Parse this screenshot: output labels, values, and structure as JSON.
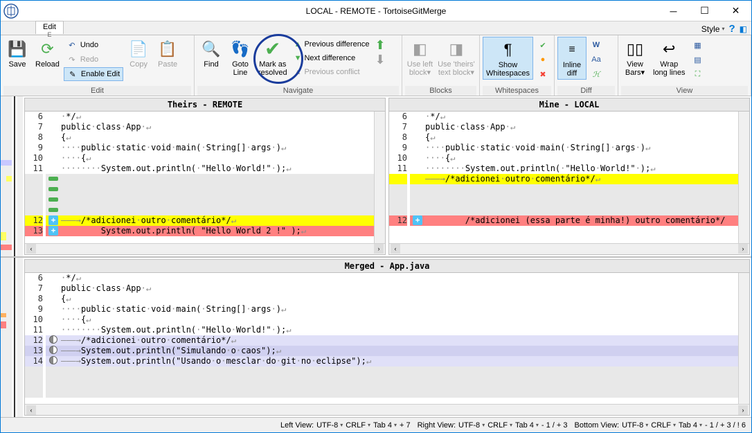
{
  "window": {
    "title": "LOCAL - REMOTE - TortoiseGitMerge",
    "style_label": "Style"
  },
  "tab": {
    "label": "Edit",
    "accel": "E"
  },
  "ribbon": {
    "save": "Save",
    "reload": "Reload",
    "undo": "Undo",
    "redo": "Redo",
    "enable_edit": "Enable Edit",
    "copy": "Copy",
    "paste": "Paste",
    "find": "Find",
    "goto_line": "Goto\nLine",
    "mark_resolved": "Mark as\nresolved",
    "prev_diff": "Previous difference",
    "next_diff": "Next difference",
    "prev_conflict": "Previous conflict",
    "use_left": "Use left\nblock▾",
    "use_theirs": "Use 'theirs'\ntext block▾",
    "show_ws": "Show\nWhitespaces",
    "inline_diff": "Inline\ndiff",
    "view_bars": "View\nBars▾",
    "wrap": "Wrap\nlong lines",
    "groups": {
      "edit": "Edit",
      "navigate": "Navigate",
      "blocks": "Blocks",
      "whitespaces": "Whitespaces",
      "diff": "Diff",
      "view": "View"
    }
  },
  "panes": {
    "theirs_title": "Theirs - REMOTE",
    "mine_title": "Mine - LOCAL",
    "merged_title": "Merged - App.java"
  },
  "theirs_lines": [
    {
      "n": "6",
      "cls": "",
      "t": "·*/↵"
    },
    {
      "n": "7",
      "cls": "",
      "t": "public·class·App·↵"
    },
    {
      "n": "8",
      "cls": "",
      "t": "{↵"
    },
    {
      "n": "9",
      "cls": "",
      "t": "····public·static·void·main(·String[]·args·)↵"
    },
    {
      "n": "10",
      "cls": "",
      "t": "····{↵"
    },
    {
      "n": "11",
      "cls": "",
      "t": "········System.out.println(·\"Hello·World!\"·);↵"
    },
    {
      "n": "",
      "cls": "gray",
      "t": "",
      "mark": "green"
    },
    {
      "n": "",
      "cls": "gray",
      "t": "",
      "mark": "green"
    },
    {
      "n": "",
      "cls": "gray",
      "t": "",
      "mark": "green"
    },
    {
      "n": "",
      "cls": "gray",
      "t": "",
      "mark": "green"
    },
    {
      "n": "12",
      "cls": "yellow",
      "t": "———→/*adicionei·outro·comentário*/↵",
      "mark": "add"
    },
    {
      "n": "13",
      "cls": "red",
      "t": "        System.out.println( \"Hello World 2 !\" );↵",
      "mark": "add"
    }
  ],
  "mine_lines": [
    {
      "n": "6",
      "cls": "",
      "t": "·*/↵"
    },
    {
      "n": "7",
      "cls": "",
      "t": "public·class·App·↵"
    },
    {
      "n": "8",
      "cls": "",
      "t": "{↵"
    },
    {
      "n": "9",
      "cls": "",
      "t": "····public·static·void·main(·String[]·args·)↵"
    },
    {
      "n": "10",
      "cls": "",
      "t": "····{↵"
    },
    {
      "n": "11",
      "cls": "",
      "t": "········System.out.println(·\"Hello·World!\"·);↵"
    },
    {
      "n": "",
      "cls": "yellow",
      "t": "———→/*adicionei·outro·comentário*/↵"
    },
    {
      "n": "",
      "cls": "gray",
      "t": ""
    },
    {
      "n": "",
      "cls": "gray",
      "t": ""
    },
    {
      "n": "",
      "cls": "gray",
      "t": ""
    },
    {
      "n": "12",
      "cls": "red",
      "t": "        /*adicionei (essa parte é minha!) outro comentário*/",
      "mark": "add"
    }
  ],
  "merged_lines": [
    {
      "n": "6",
      "cls": "",
      "t": "·*/↵"
    },
    {
      "n": "7",
      "cls": "",
      "t": "public·class·App·↵"
    },
    {
      "n": "8",
      "cls": "",
      "t": "{↵"
    },
    {
      "n": "9",
      "cls": "",
      "t": "····public·static·void·main(·String[]·args·)↵"
    },
    {
      "n": "10",
      "cls": "",
      "t": "····{↵"
    },
    {
      "n": "11",
      "cls": "",
      "t": "········System.out.println(·\"Hello·World!\"·);↵"
    },
    {
      "n": "12",
      "cls": "lav",
      "t": "———→/*adicionei·outro·comentário*/↵",
      "mark": "res"
    },
    {
      "n": "13",
      "cls": "lavd",
      "t": "———→System.out.println(\"Simulando·o·caos\");↵",
      "mark": "res"
    },
    {
      "n": "14",
      "cls": "lav",
      "t": "———→System.out.println(\"Usando·o·mesclar·do·git·no·eclipse\");↵",
      "mark": "res"
    },
    {
      "n": "",
      "cls": "gray",
      "t": ""
    },
    {
      "n": "",
      "cls": "gray",
      "t": ""
    },
    {
      "n": "",
      "cls": "gray",
      "t": ""
    }
  ],
  "status": {
    "left_view": "Left View:",
    "right_view": "Right View:",
    "bottom_view": "Bottom View:",
    "enc": "UTF-8",
    "eol": "CRLF",
    "tab": "Tab 4",
    "left_diff": "+ 7",
    "right_diff": "- 1 / + 3",
    "bottom_diff": "- 1 / + 3 / ! 6"
  }
}
